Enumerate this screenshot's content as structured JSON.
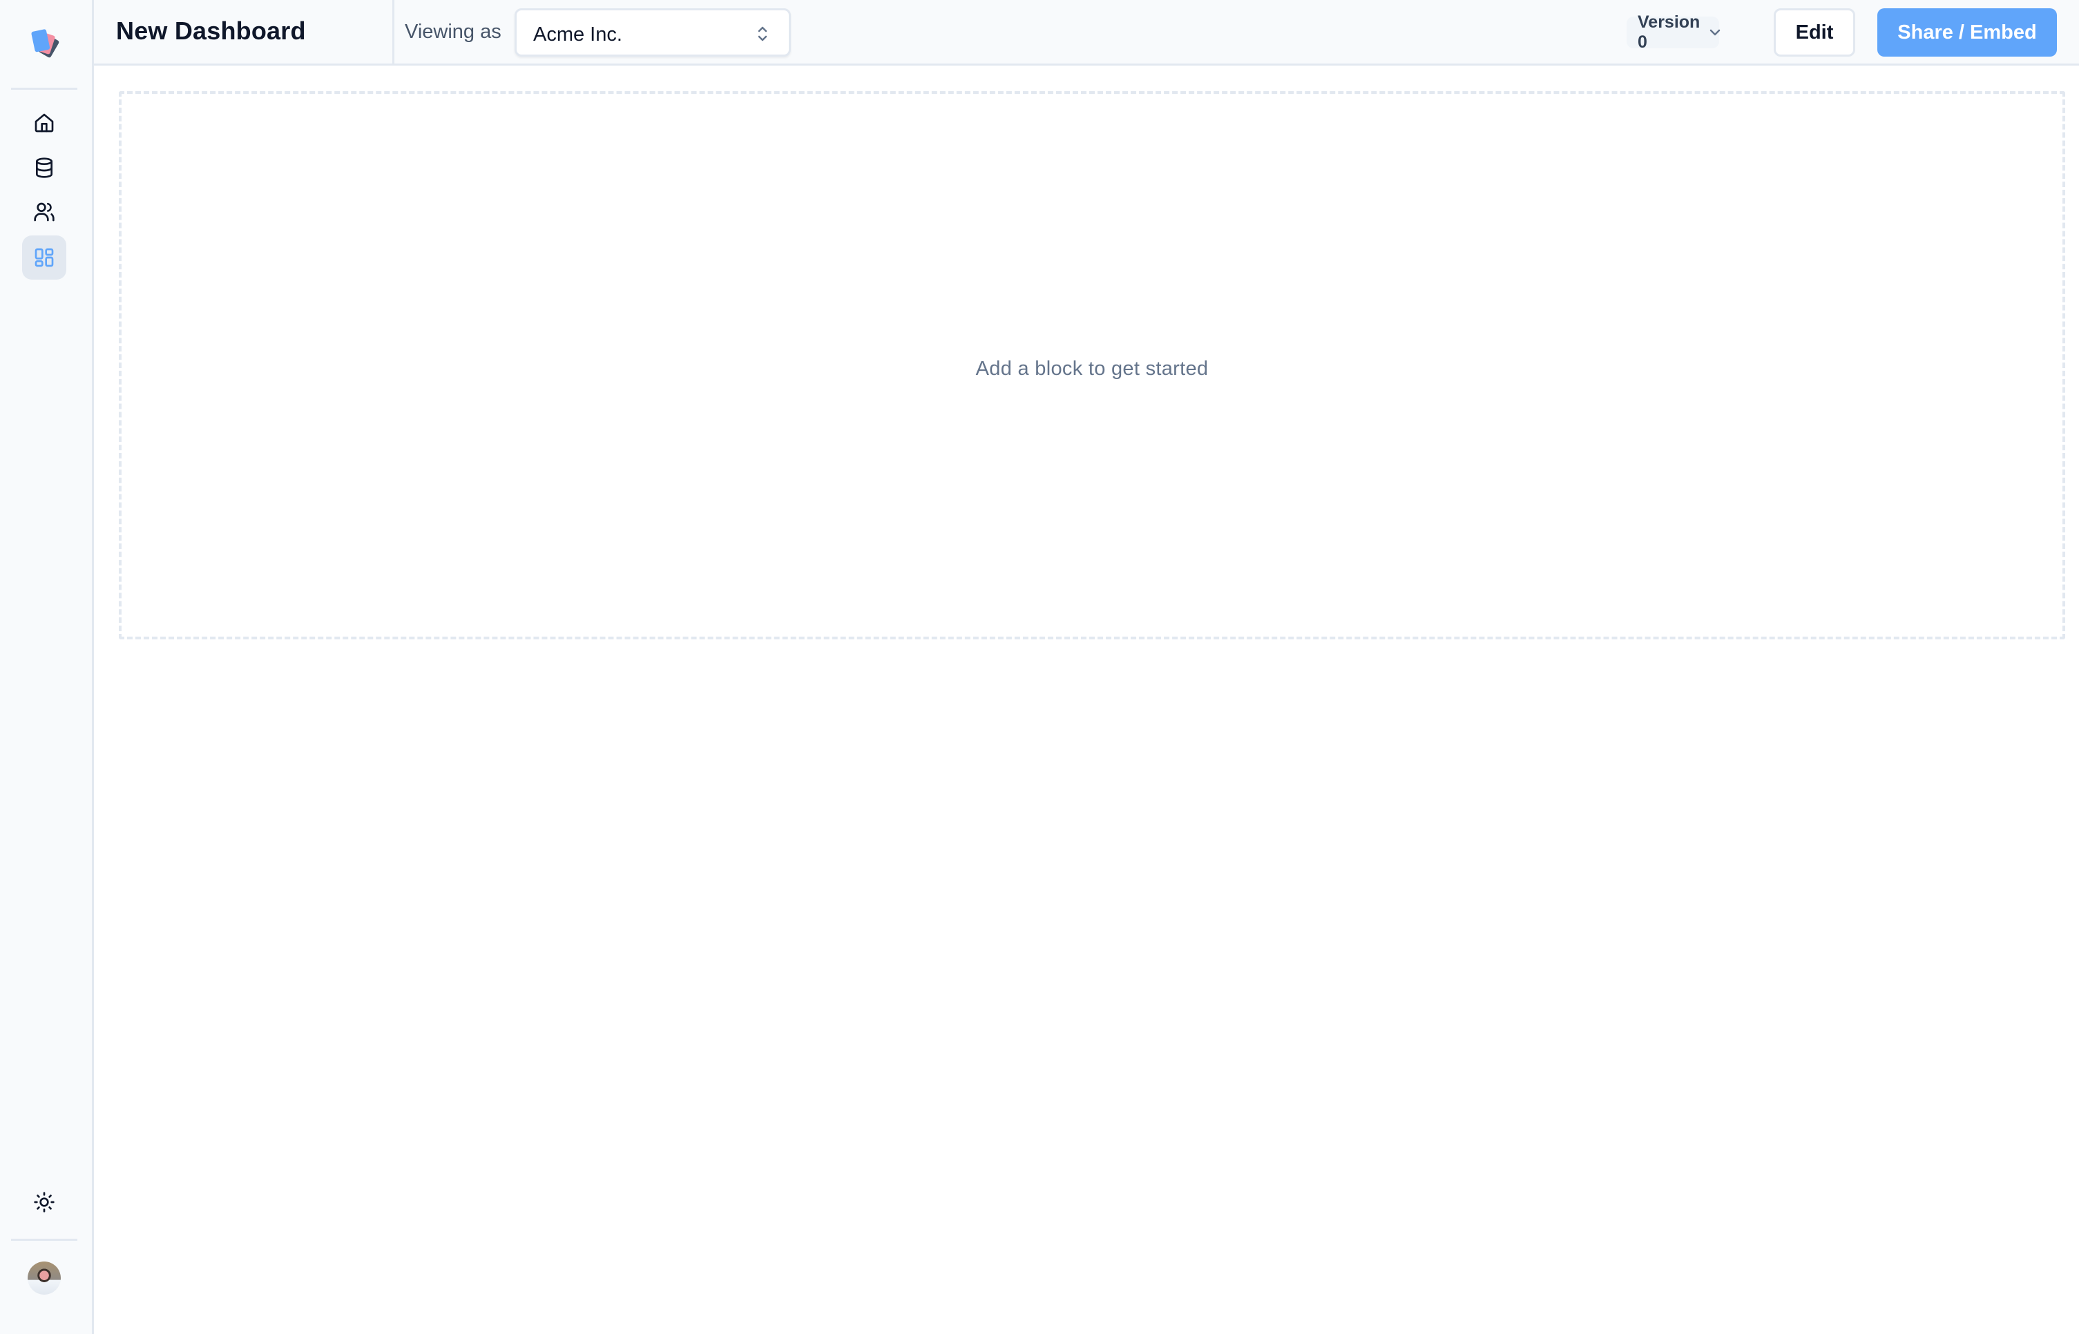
{
  "sidebar": {
    "logo": "app-logo",
    "items": [
      {
        "id": "home",
        "icon": "home-icon",
        "active": false
      },
      {
        "id": "data-sources",
        "icon": "database-icon",
        "active": false
      },
      {
        "id": "users",
        "icon": "users-icon",
        "active": false
      },
      {
        "id": "dashboards",
        "icon": "dashboard-layout-icon",
        "active": true
      }
    ],
    "bottom": {
      "theme_icon": "sun-icon",
      "avatar": "user-avatar"
    }
  },
  "header": {
    "title": "New Dashboard",
    "viewing_as_label": "Viewing as",
    "viewing_as_value": "Acme Inc.",
    "version_label": "Version 0",
    "edit_label": "Edit",
    "share_label": "Share / Embed"
  },
  "main": {
    "empty_state": "Add a block to get started"
  },
  "colors": {
    "accent": "#60a5fa",
    "border": "#e2e8f0",
    "sidebar_bg": "#f8fafc",
    "muted_text": "#64748b"
  }
}
